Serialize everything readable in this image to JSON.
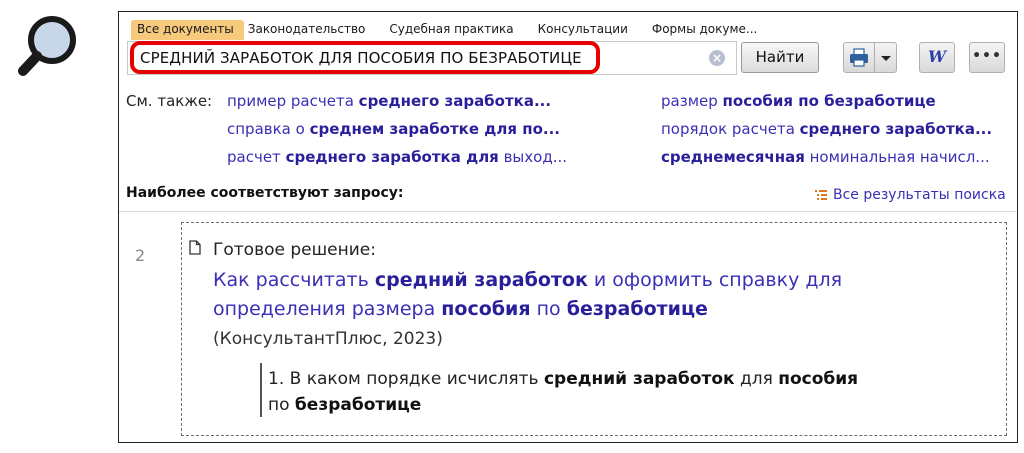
{
  "colors": {
    "accent": "#3a2fb5",
    "active_tab": "#f6c97d",
    "highlight": "#e60000"
  },
  "tabs": [
    {
      "label": "Все документы",
      "active": true
    },
    {
      "label": "Законодательство"
    },
    {
      "label": "Судебная практика"
    },
    {
      "label": "Консультации"
    },
    {
      "label": "Формы докуме..."
    }
  ],
  "search": {
    "value": "СРЕДНИЙ ЗАРАБОТОК ДЛЯ ПОСОБИЯ ПО БЕЗРАБОТИЦЕ",
    "find_label": "Найти"
  },
  "toolbar": {
    "print_icon": "printer-icon",
    "word_label": "W",
    "more_label": "•••"
  },
  "see_also": {
    "label": "См. также:",
    "links": [
      {
        "pre": "пример расчета ",
        "bold": "среднего заработка...",
        "post": ""
      },
      {
        "pre": "справка о ",
        "bold": "среднем заработке для по...",
        "post": ""
      },
      {
        "pre": "расчет ",
        "bold": "среднего заработка для",
        "post": " выход..."
      },
      {
        "pre": "размер ",
        "bold": "пособия по безработице",
        "post": ""
      },
      {
        "pre": "порядок расчета ",
        "bold": "среднего заработка...",
        "post": ""
      },
      {
        "pre": "",
        "bold": "среднемесячная",
        "post": " номинальная начисл..."
      }
    ]
  },
  "best_match": {
    "label": "Наиболее соответствуют запросу:",
    "all_results": "Все результаты поиска"
  },
  "result": {
    "number": "2",
    "type": "Готовое решение:",
    "title_l1": {
      "a": "Как рассчитать ",
      "b": "средний заработок",
      "c": " и оформить справку для"
    },
    "title_l2": {
      "a": "определения размера ",
      "b": "пособия",
      "c": " по ",
      "d": "безработице"
    },
    "source": "(КонсультантПлюс, 2023)",
    "quote_l1": {
      "a": "1. В каком порядке исчислять ",
      "b": "средний заработок",
      "c": " для ",
      "d": "пособия"
    },
    "quote_l2": {
      "a": "по ",
      "b": "безработице"
    }
  }
}
